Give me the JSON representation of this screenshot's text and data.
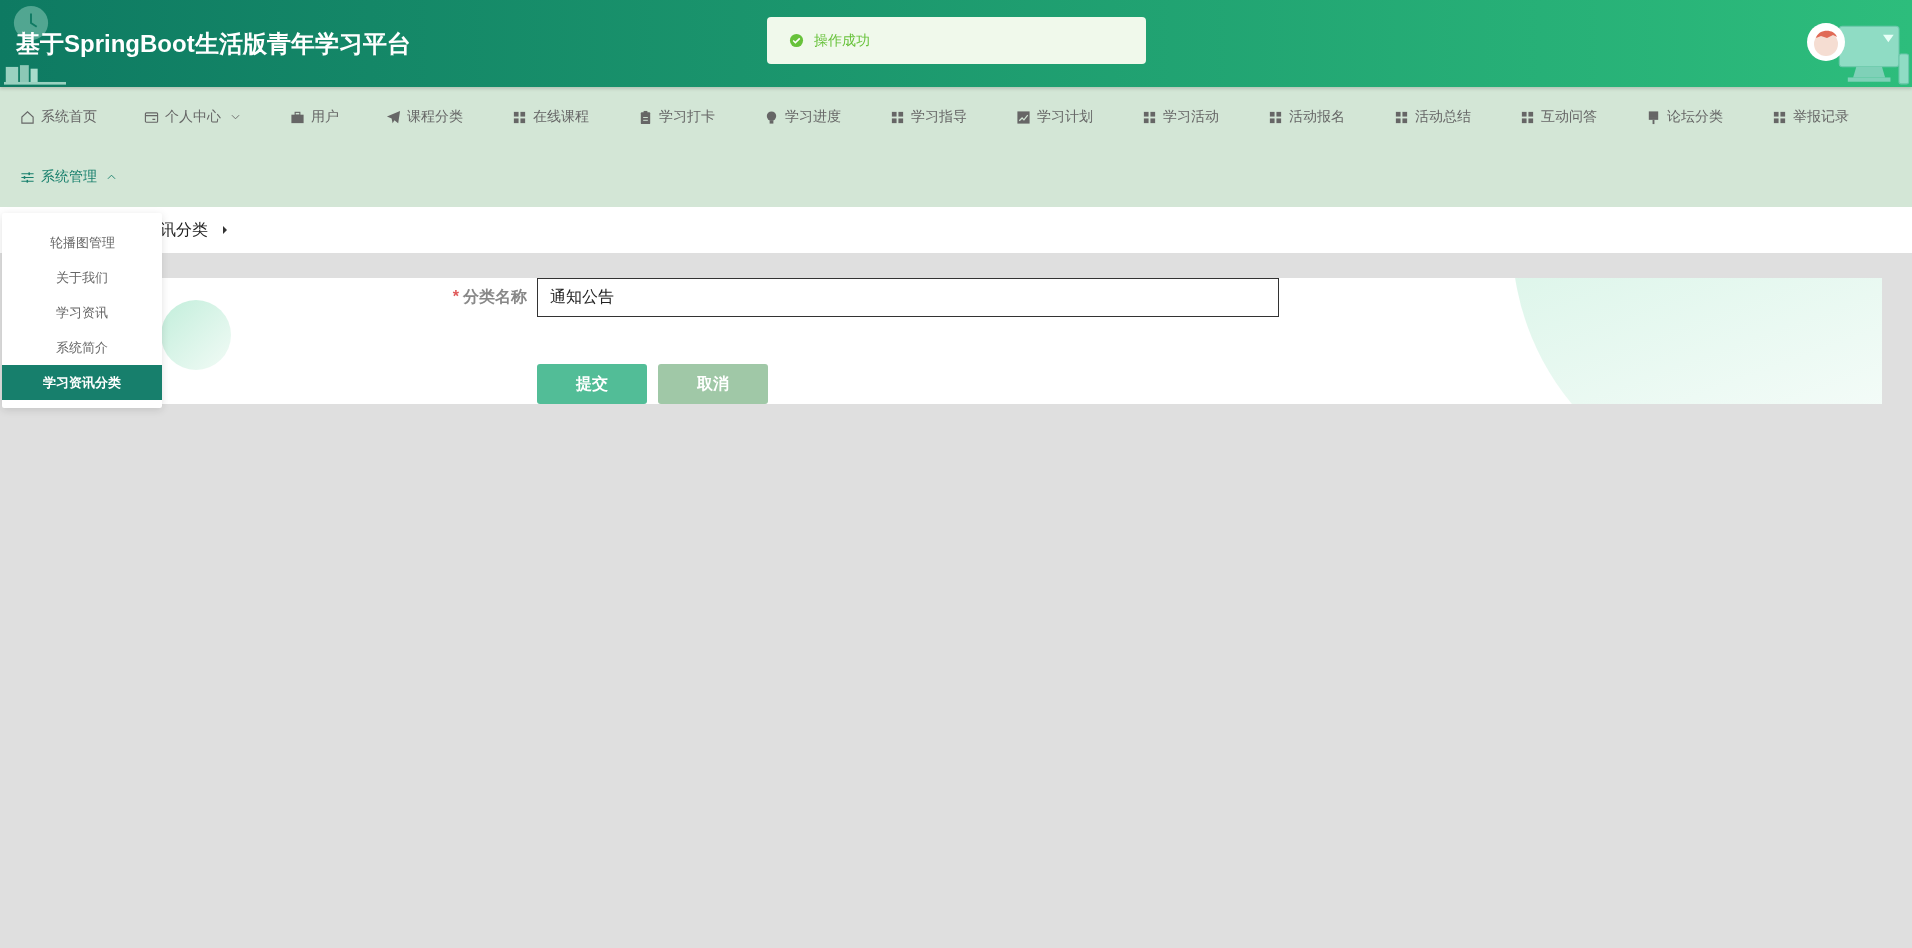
{
  "header": {
    "title": "基于SpringBoot生活版青年学习平台"
  },
  "toast": {
    "message": "操作成功"
  },
  "nav": {
    "items": [
      {
        "label": "系统首页"
      },
      {
        "label": "个人中心",
        "expanded": false
      },
      {
        "label": "用户"
      },
      {
        "label": "课程分类"
      },
      {
        "label": "在线课程"
      },
      {
        "label": "学习打卡"
      },
      {
        "label": "学习进度"
      },
      {
        "label": "学习指导"
      },
      {
        "label": "学习计划"
      },
      {
        "label": "学习活动"
      },
      {
        "label": "活动报名"
      },
      {
        "label": "活动总结"
      },
      {
        "label": "互动问答"
      },
      {
        "label": "论坛分类"
      },
      {
        "label": "举报记录"
      },
      {
        "label": "系统管理",
        "expanded": true,
        "children": [
          {
            "label": "轮播图管理",
            "selected": false
          },
          {
            "label": "关于我们",
            "selected": false
          },
          {
            "label": "学习资讯",
            "selected": false
          },
          {
            "label": "系统简介",
            "selected": false
          },
          {
            "label": "学习资讯分类",
            "selected": true
          }
        ]
      }
    ]
  },
  "breadcrumb": {
    "text": "讯分类"
  },
  "form": {
    "field": {
      "label": "分类名称",
      "required_mark": "*",
      "value": "通知公告"
    },
    "buttons": [
      {
        "label": "提交",
        "kind": "primary"
      },
      {
        "label": "取消",
        "kind": "cancel"
      }
    ]
  }
}
